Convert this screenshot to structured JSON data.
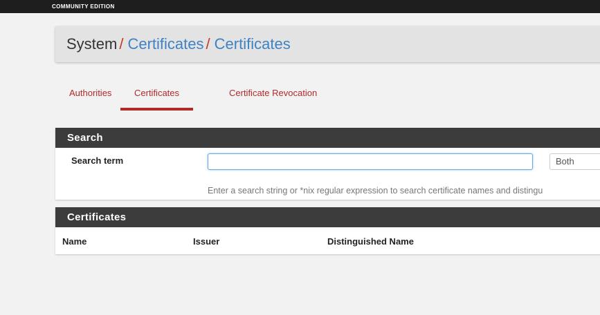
{
  "topbar": {
    "edition_text": "COMMUNITY EDITION"
  },
  "breadcrumb": {
    "root": "System",
    "separator": "/",
    "level1": "Certificates",
    "level2": "Certificates"
  },
  "tabs": [
    {
      "label": "Authorities",
      "active": false
    },
    {
      "label": "Certificates",
      "active": true
    },
    {
      "label": "Certificate Revocation",
      "active": false
    }
  ],
  "search": {
    "panel_title": "Search",
    "term_label": "Search term",
    "input_value": "",
    "scope_selected": "Both",
    "help_text": "Enter a search string or *nix regular expression to search certificate names and distingu"
  },
  "certificates": {
    "panel_title": "Certificates",
    "columns": [
      "Name",
      "Issuer",
      "Distinguished Name"
    ]
  },
  "colors": {
    "accent_red": "#b02a2a",
    "link_blue": "#3f82c4",
    "panel_header": "#3c3c3c",
    "topbar": "#1e1e1e"
  }
}
